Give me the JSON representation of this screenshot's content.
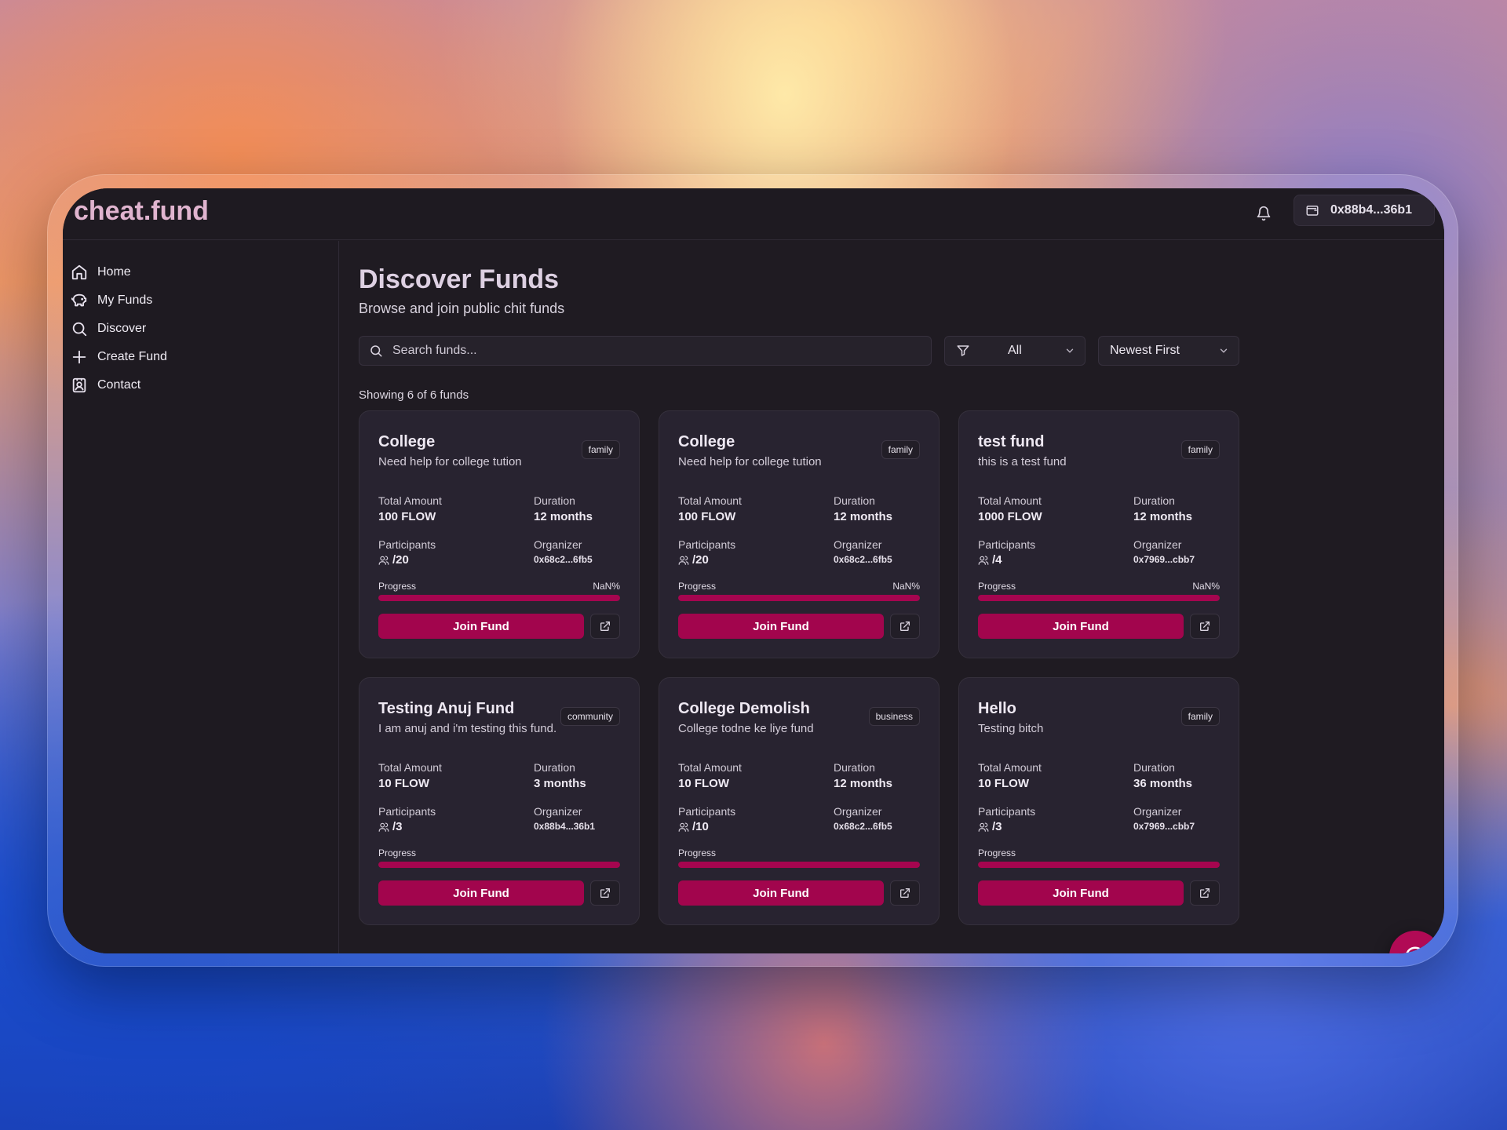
{
  "app": {
    "brand": "cheat.fund",
    "wallet_address": "0x88b4...36b1"
  },
  "sidebar": {
    "items": [
      {
        "label": "Home",
        "icon": "home-icon"
      },
      {
        "label": "My Funds",
        "icon": "piggy-bank-icon"
      },
      {
        "label": "Discover",
        "icon": "search-icon"
      },
      {
        "label": "Create Fund",
        "icon": "plus-icon"
      },
      {
        "label": "Contact",
        "icon": "contact-icon"
      }
    ]
  },
  "page": {
    "title": "Discover Funds",
    "subtitle": "Browse and join public chit funds",
    "search_placeholder": "Search funds...",
    "filter_value": "All",
    "sort_value": "Newest First",
    "count_text": "Showing 6 of 6 funds"
  },
  "labels": {
    "total_amount": "Total Amount",
    "duration": "Duration",
    "participants": "Participants",
    "organizer": "Organizer",
    "progress": "Progress",
    "join": "Join Fund"
  },
  "colors": {
    "accent": "#a2054d",
    "background": "#1f1b22",
    "card": "#282330"
  },
  "funds": [
    {
      "title": "College",
      "description": "Need help for college tution",
      "tag": "family",
      "total_amount": "100 FLOW",
      "duration": "12 months",
      "participants": "/20",
      "organizer": "0x68c2...6fb5",
      "progress_text": "NaN%",
      "progress_fill": 1.0
    },
    {
      "title": "College",
      "description": "Need help for college tution",
      "tag": "family",
      "total_amount": "100 FLOW",
      "duration": "12 months",
      "participants": "/20",
      "organizer": "0x68c2...6fb5",
      "progress_text": "NaN%",
      "progress_fill": 1.0
    },
    {
      "title": "test fund",
      "description": "this is a test fund",
      "tag": "family",
      "total_amount": "1000 FLOW",
      "duration": "12 months",
      "participants": "/4",
      "organizer": "0x7969...cbb7",
      "progress_text": "NaN%",
      "progress_fill": 1.0
    },
    {
      "title": "Testing Anuj Fund",
      "description": "I am anuj and i'm testing this fund.",
      "tag": "community",
      "total_amount": "10 FLOW",
      "duration": "3 months",
      "participants": "/3",
      "organizer": "0x88b4...36b1",
      "progress_text": "",
      "progress_fill": 1.0
    },
    {
      "title": "College Demolish",
      "description": "College todne ke liye fund",
      "tag": "business",
      "total_amount": "10 FLOW",
      "duration": "12 months",
      "participants": "/10",
      "organizer": "0x68c2...6fb5",
      "progress_text": "",
      "progress_fill": 1.0
    },
    {
      "title": "Hello",
      "description": "Testing bitch",
      "tag": "family",
      "total_amount": "10 FLOW",
      "duration": "36 months",
      "participants": "/3",
      "organizer": "0x7969...cbb7",
      "progress_text": "",
      "progress_fill": 1.0
    }
  ]
}
